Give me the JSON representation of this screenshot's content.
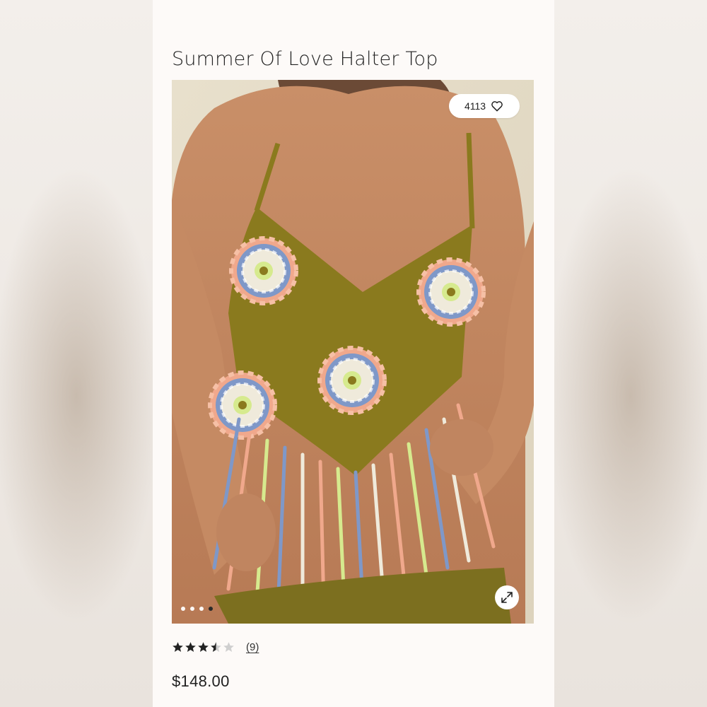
{
  "product": {
    "title": "Summer Of Love Halter Top",
    "like_count": "4113",
    "rating": 3.5,
    "rating_max": 5,
    "review_count": "(9)",
    "price": "$148.00"
  },
  "gallery": {
    "total_images": 4,
    "active_index": 3
  },
  "icons": {
    "like": "heart-outline-icon",
    "expand": "expand-arrows-icon",
    "star": "star-icon"
  },
  "colors": {
    "card_bg": "#fdfaf8",
    "text": "#222222",
    "crochet_olive": "#8a7a1e",
    "crochet_peach": "#f0a88c",
    "crochet_blue": "#7f98c8",
    "crochet_cream": "#efeadb",
    "crochet_lime": "#d6ea8e"
  }
}
